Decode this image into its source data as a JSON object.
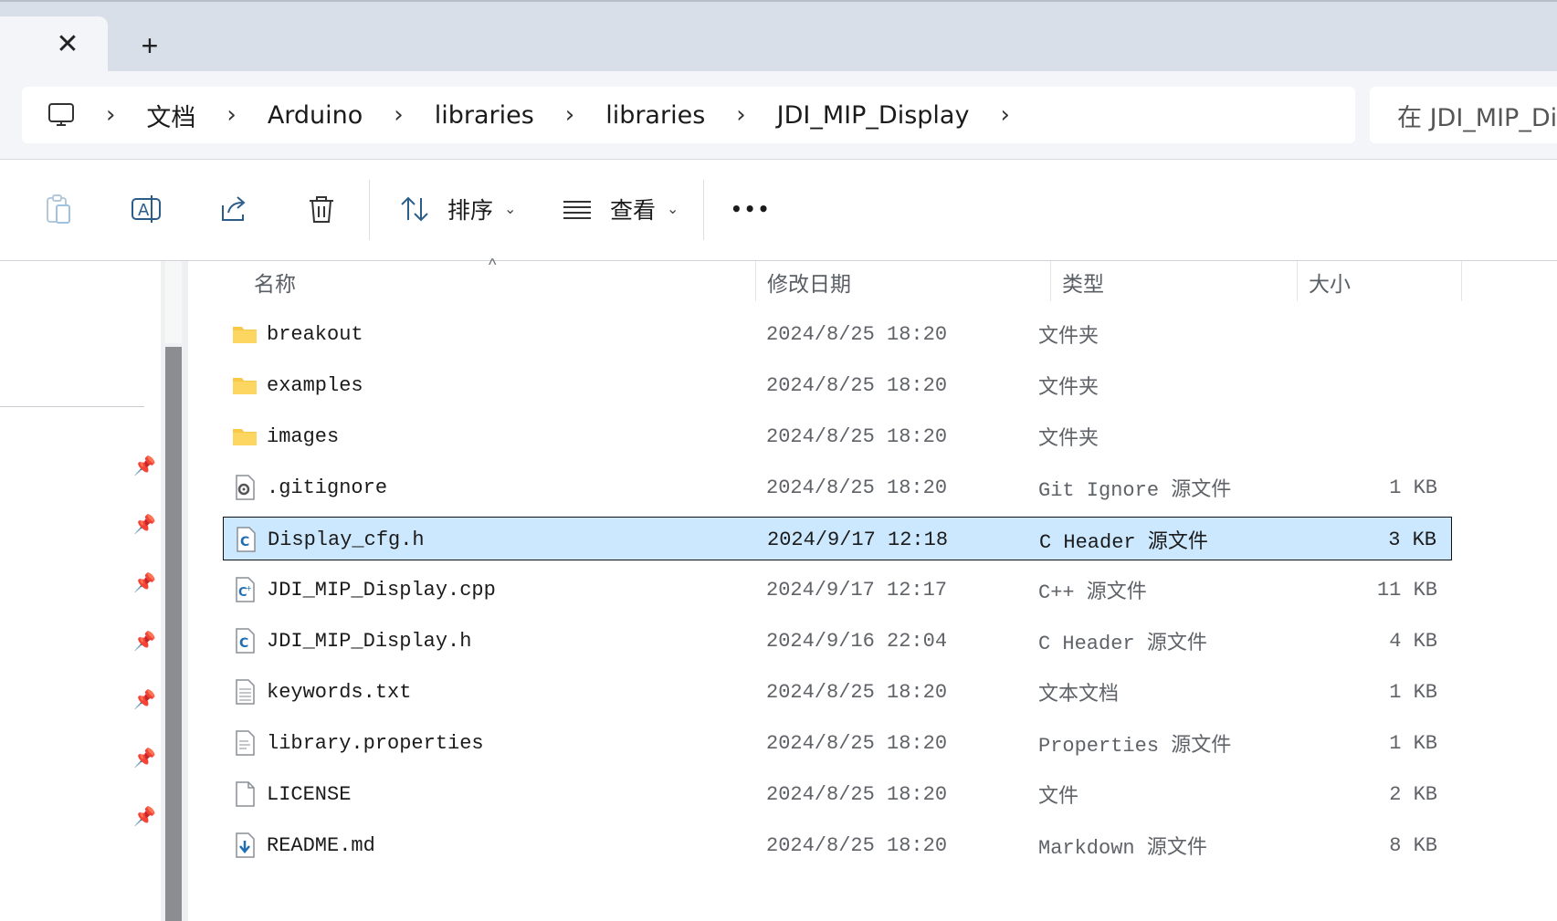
{
  "tabbar": {
    "close_icon": "close-icon",
    "new_tab_icon": "plus-icon"
  },
  "address": {
    "root_icon": "computer-icon",
    "crumbs": [
      "文档",
      "Arduino",
      "libraries",
      "libraries",
      "JDI_MIP_Display"
    ],
    "separator": "›",
    "search_placeholder": "在 JDI_MIP_Dis"
  },
  "toolbar": {
    "sort_label": "排序",
    "view_label": "查看",
    "more_label": "•••"
  },
  "columns": {
    "name": "名称",
    "date": "修改日期",
    "type": "类型",
    "size": "大小"
  },
  "files": [
    {
      "name": "breakout",
      "date": "2024/8/25 18:20",
      "type": "文件夹",
      "size": "",
      "icon": "folder-icon"
    },
    {
      "name": "examples",
      "date": "2024/8/25 18:20",
      "type": "文件夹",
      "size": "",
      "icon": "folder-icon"
    },
    {
      "name": "images",
      "date": "2024/8/25 18:20",
      "type": "文件夹",
      "size": "",
      "icon": "folder-icon"
    },
    {
      "name": ".gitignore",
      "date": "2024/8/25 18:20",
      "type": "Git Ignore 源文件",
      "size": "1 KB",
      "icon": "settings-file-icon"
    },
    {
      "name": "Display_cfg.h",
      "date": "2024/9/17 12:18",
      "type": "C Header 源文件",
      "size": "3 KB",
      "icon": "c-header-file-icon",
      "selected": true
    },
    {
      "name": "JDI_MIP_Display.cpp",
      "date": "2024/9/17 12:17",
      "type": "C++ 源文件",
      "size": "11 KB",
      "icon": "cpp-file-icon"
    },
    {
      "name": "JDI_MIP_Display.h",
      "date": "2024/9/16 22:04",
      "type": "C Header 源文件",
      "size": "4 KB",
      "icon": "c-header-file-icon"
    },
    {
      "name": "keywords.txt",
      "date": "2024/8/25 18:20",
      "type": "文本文档",
      "size": "1 KB",
      "icon": "text-file-icon"
    },
    {
      "name": "library.properties",
      "date": "2024/8/25 18:20",
      "type": "Properties 源文件",
      "size": "1 KB",
      "icon": "properties-file-icon"
    },
    {
      "name": "LICENSE",
      "date": "2024/8/25 18:20",
      "type": "文件",
      "size": "2 KB",
      "icon": "blank-file-icon"
    },
    {
      "name": "README.md",
      "date": "2024/8/25 18:20",
      "type": "Markdown 源文件",
      "size": "8 KB",
      "icon": "markdown-file-icon"
    }
  ],
  "colors": {
    "selection": "#cce8ff",
    "folder": "#f8c94a",
    "accent": "#1f6fb2"
  }
}
